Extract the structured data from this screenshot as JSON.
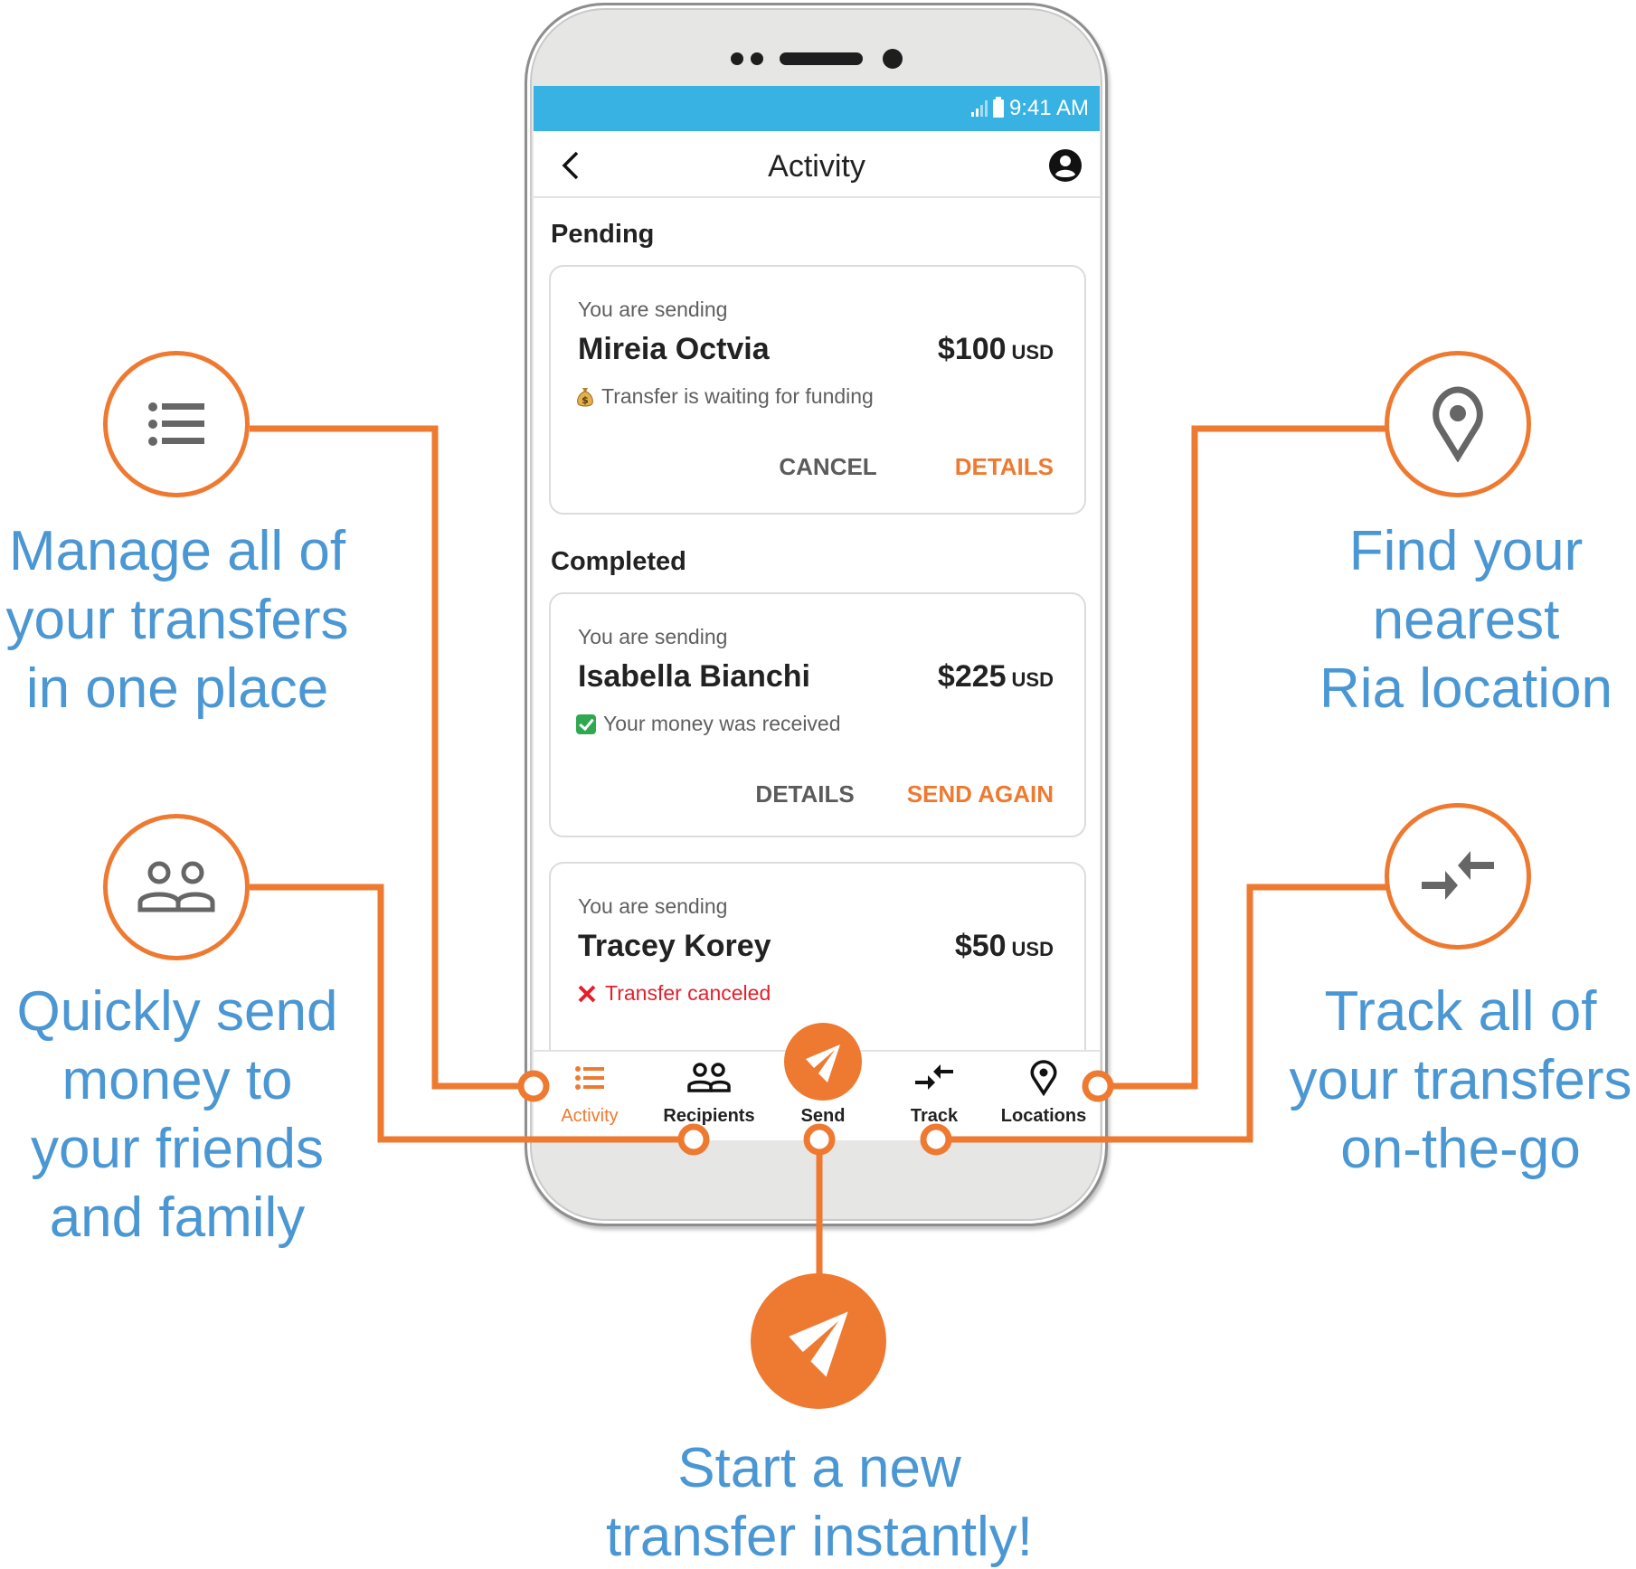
{
  "status_bar": {
    "time": "9:41 AM",
    "icons": [
      "signal-icon",
      "battery-icon"
    ]
  },
  "app_bar": {
    "title": "Activity",
    "back_icon": "chevron-left-icon",
    "profile_icon": "account-circle-icon"
  },
  "sections": {
    "pending_label": "Pending",
    "completed_label": "Completed"
  },
  "transfers": [
    {
      "section": "Pending",
      "caption": "You are sending",
      "recipient": "Mireia Octvia",
      "amount": "$100",
      "currency": "USD",
      "status_icon": "money-bag-icon",
      "status": "Transfer is waiting for funding",
      "actions": [
        {
          "label": "CANCEL",
          "style": "gray"
        },
        {
          "label": "DETAILS",
          "style": "orange"
        }
      ]
    },
    {
      "section": "Completed",
      "caption": "You are sending",
      "recipient": "Isabella Bianchi",
      "amount": "$225",
      "currency": "USD",
      "status_icon": "check-box-icon",
      "status": "Your money was received",
      "actions": [
        {
          "label": "DETAILS",
          "style": "gray"
        },
        {
          "label": "SEND AGAIN",
          "style": "orange"
        }
      ]
    },
    {
      "section": "Completed",
      "caption": "You are sending",
      "recipient": "Tracey Korey",
      "amount": "$50",
      "currency": "USD",
      "status_icon": "red-x-icon",
      "status": "Transfer canceled"
    }
  ],
  "tab_bar": {
    "active": "Activity",
    "tabs": [
      {
        "label": "Activity",
        "icon": "list-icon"
      },
      {
        "label": "Recipients",
        "icon": "people-icon"
      },
      {
        "label": "Send",
        "icon": "paper-plane-icon"
      },
      {
        "label": "Track",
        "icon": "arrows-converge-icon"
      },
      {
        "label": "Locations",
        "icon": "map-pin-icon"
      }
    ]
  },
  "features": {
    "manage": {
      "icon": "list-icon",
      "lines": [
        "Manage all of",
        "your transfers",
        "in one place"
      ]
    },
    "recipients": {
      "icon": "people-icon",
      "lines": [
        "Quickly send",
        "money to",
        "your friends",
        "and family"
      ]
    },
    "locations": {
      "icon": "map-pin-icon",
      "lines": [
        "Find your",
        "nearest",
        "Ria location"
      ]
    },
    "track": {
      "icon": "arrows-converge-icon",
      "lines": [
        "Track all of",
        "your transfers",
        "on-the-go"
      ]
    },
    "send": {
      "icon": "paper-plane-icon",
      "lines": [
        "Start a new",
        "transfer instantly!"
      ]
    }
  },
  "colors": {
    "accent_orange": "#ee7a31",
    "status_bar_blue": "#38b2e2",
    "feature_text_blue": "#4a97d3",
    "canceled_red": "#e3202c",
    "success_green": "#2fa84f"
  }
}
